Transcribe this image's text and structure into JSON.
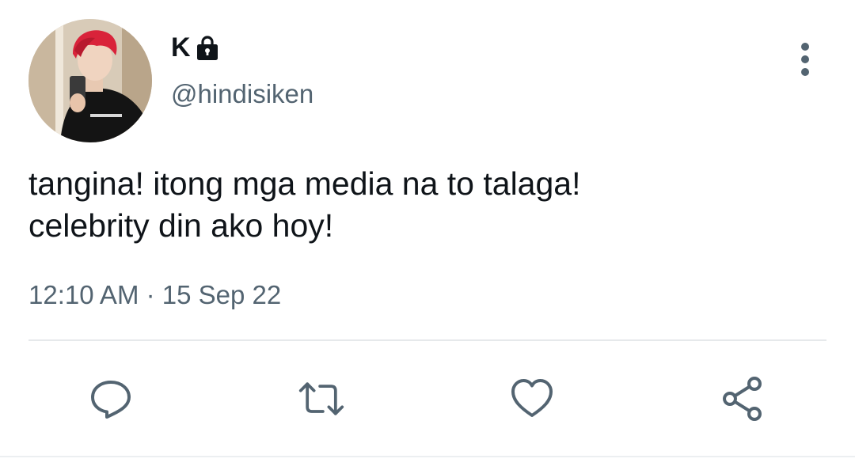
{
  "tweet": {
    "author": {
      "display_name": "K",
      "handle": "@hindisiken",
      "protected": true
    },
    "text_lines": [
      "tangina! itong mga media na to talaga!",
      "celebrity din ako hoy!"
    ],
    "timestamp": "12:10 AM · 15 Sep 22"
  },
  "icons": {
    "lock": "lock-icon",
    "more": "more-vertical-icon",
    "reply": "reply-icon",
    "retweet": "retweet-icon",
    "like": "heart-icon",
    "share": "share-icon"
  },
  "colors": {
    "text_primary": "#0f1419",
    "text_secondary": "#536471",
    "divider": "#e6e9eb"
  }
}
